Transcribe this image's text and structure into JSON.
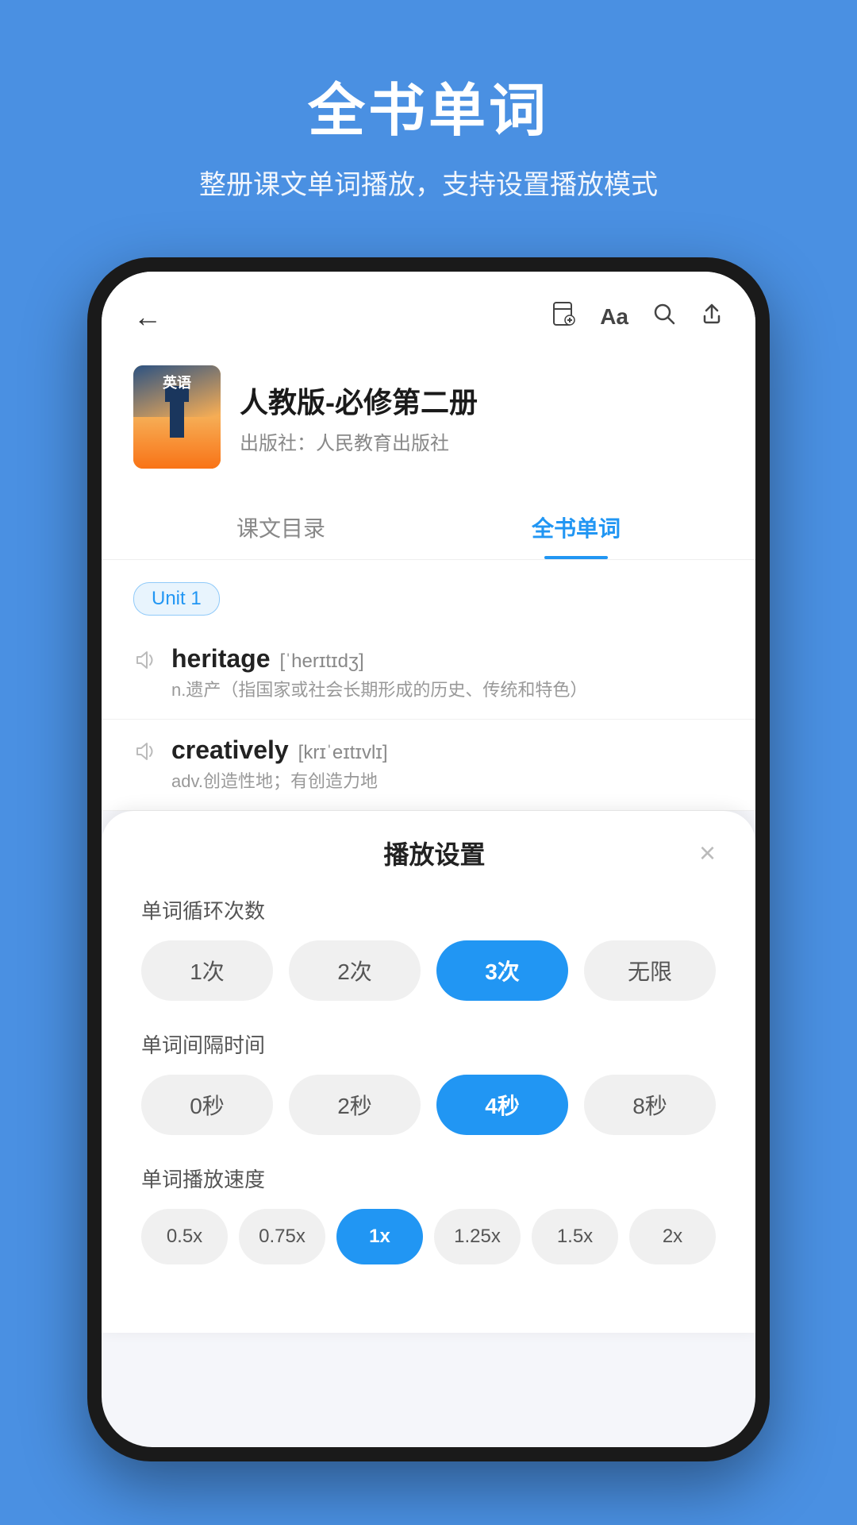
{
  "hero": {
    "title": "全书单词",
    "subtitle": "整册课文单词播放，支持设置播放模式"
  },
  "phone": {
    "back_icon": "←",
    "icons": [
      "⊟",
      "Aa",
      "🔍",
      "⬆"
    ]
  },
  "book": {
    "title": "人教版-必修第二册",
    "publisher_label": "出版社：人民教育出版社",
    "cover_text": "英语"
  },
  "tabs": [
    {
      "label": "课文目录",
      "active": false
    },
    {
      "label": "全书单词",
      "active": true
    }
  ],
  "unit_badge": "Unit 1",
  "words": [
    {
      "word": "heritage",
      "phonetic": "[ˈherɪtɪdʒ]",
      "definition": "n.遗产（指国家或社会长期形成的历史、传统和特色）"
    },
    {
      "word": "creatively",
      "phonetic": "[krɪˈeɪtɪvlɪ]",
      "definition": "adv.创造性地；有创造力地"
    }
  ],
  "settings": {
    "title": "播放设置",
    "close_icon": "×",
    "loop_count": {
      "label": "单词循环次数",
      "options": [
        "1次",
        "2次",
        "3次",
        "无限"
      ],
      "active_index": 2
    },
    "interval": {
      "label": "单词间隔时间",
      "options": [
        "0秒",
        "2秒",
        "4秒",
        "8秒"
      ],
      "active_index": 2
    },
    "speed": {
      "label": "单词播放速度",
      "options": [
        "0.5x",
        "0.75x",
        "1x",
        "1.25x",
        "1.5x",
        "2x"
      ],
      "active_index": 2
    }
  }
}
